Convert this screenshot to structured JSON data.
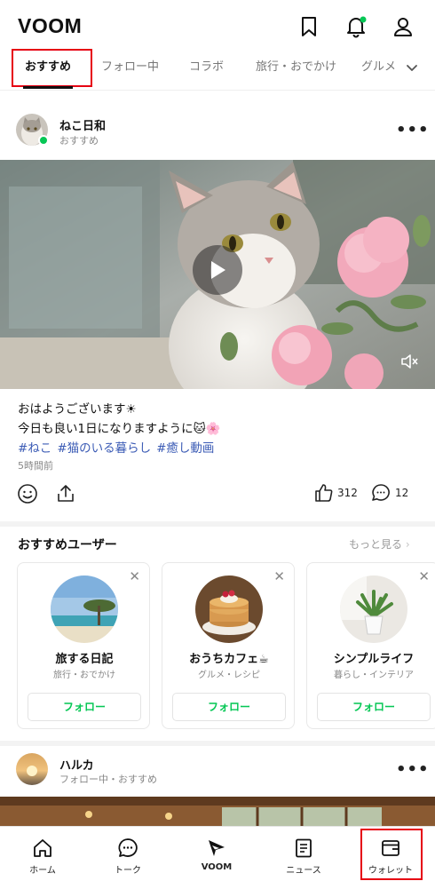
{
  "header": {
    "logo": "VOOM"
  },
  "tabs": [
    {
      "label": "おすすめ"
    },
    {
      "label": "フォロー中"
    },
    {
      "label": "コラボ"
    },
    {
      "label": "旅行・おでかけ"
    },
    {
      "label": "グルメ"
    }
  ],
  "post1": {
    "author": "ねこ日和",
    "subtitle": "おすすめ",
    "caption_line1": "おはようございます☀",
    "caption_line2": "今日も良い1日になりますように🐱🌸",
    "hashtags": [
      "#ねこ",
      "#猫のいる暮らし",
      "#癒し動画"
    ],
    "time": "5時間前",
    "likes": "312",
    "comments": "12"
  },
  "recommend": {
    "title": "おすすめユーザー",
    "more": "もっと見る",
    "cards": [
      {
        "name": "旅する日記",
        "category": "旅行・おでかけ",
        "button": "フォロー"
      },
      {
        "name": "おうちカフェ☕",
        "category": "グルメ・レシピ",
        "button": "フォロー"
      },
      {
        "name": "シンプルライフ",
        "category": "暮らし・インテリア",
        "button": "フォロー"
      }
    ]
  },
  "post2": {
    "author": "ハルカ",
    "subtitle": "フォロー中・おすすめ"
  },
  "bottom_nav": [
    {
      "label": "ホーム",
      "icon": "home-icon"
    },
    {
      "label": "トーク",
      "icon": "chat-icon"
    },
    {
      "label": "VOOM",
      "icon": "voom-icon"
    },
    {
      "label": "ニュース",
      "icon": "news-icon"
    },
    {
      "label": "ウォレット",
      "icon": "wallet-icon"
    }
  ],
  "colors": {
    "accent_green": "#06c755",
    "hashtag_blue": "#3b5bb5",
    "highlight_red": "#e60012"
  }
}
